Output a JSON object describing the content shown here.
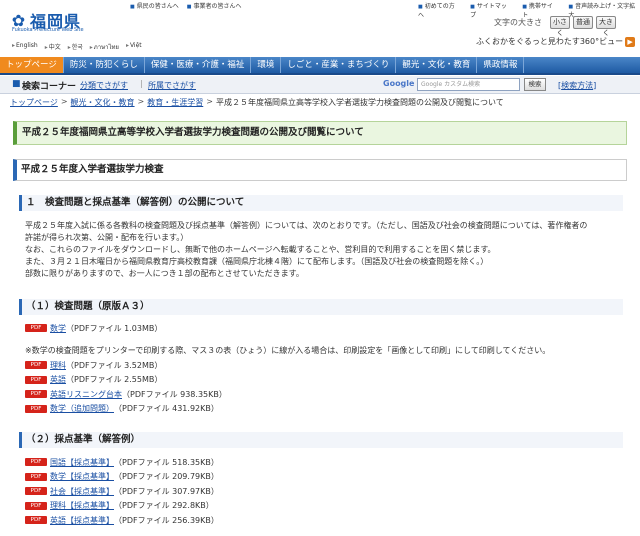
{
  "header": {
    "logo_text": "福岡県",
    "logo_sub": "Fukuoka Prefecture Web Site",
    "languages": [
      "English",
      "中文",
      "한국",
      "ภาษาไทย",
      "Việt"
    ],
    "top_links": [
      "県民の皆さんへ",
      "事業者の皆さんへ"
    ],
    "right_links": [
      "初めての方へ",
      "サイトマップ",
      "携帯サイト",
      "音声読み上げ・文字拡大"
    ],
    "font_size_label": "文字の大きさ",
    "font_buttons": [
      "小さく",
      "普通",
      "大きく"
    ],
    "view360": "ふくおかをぐるっと見わたす360°ビュー"
  },
  "nav": {
    "items": [
      "トップページ",
      "防災・防犯くらし",
      "保健・医療・介護・福祉",
      "環境",
      "しごと・産業・まちづくり",
      "観光・文化・教育",
      "県政情報"
    ]
  },
  "search": {
    "title": "検索コーナー",
    "link_category": "分類でさがす",
    "link_dept": "所属でさがす",
    "google_label": "Google",
    "placeholder": "Google カスタム検索",
    "button": "検索",
    "help_open": "[",
    "help": "検索方法",
    "help_close": "]"
  },
  "breadcrumb": [
    "トップページ",
    "観光・文化・教育",
    "教育・生涯学習",
    "平成２５年度福岡県立高等学校入学者選抜学力検査問題の公開及び閲覧について"
  ],
  "page_title": "平成２５年度福岡県立高等学校入学者選抜学力検査問題の公開及び閲覧について",
  "section_title": "平成２５年度入学者選抜学力検査",
  "subsection_title": "１　検査問題と採点基準（解答例）の公開について",
  "paragraph": [
    "平成２５年度入試に係る各教科の検査問題及び採点基準（解答例）については、次のとおりです。（ただし、国語及び社会の検査問題については、著作権者の",
    "許諾が得られ次第、公開・配布を行います。）",
    "なお、これらのファイルをダウンロードし、無断で他のホームページへ転載することや、営利目的で利用することを固く禁じます。",
    "また、３月２１日木曜日から福岡県教育庁高校教育課（福岡県庁北棟４階）にて配布します。（国語及び社会の検査問題を除く。）",
    "部数に限りがありますので、お一人につき１部の配布とさせていただきます。"
  ],
  "list1_title": "（１）検査問題（原版Ａ３）",
  "list1_first": {
    "link": "数学",
    "size": "（PDFファイル 1.03MB）"
  },
  "note": "※数学の検査問題をプリンターで印刷する際、マス３の表（ひょう）に線が入る場合は、印刷設定を「画像として印刷」にして印刷してください。",
  "list1_rest": [
    {
      "link": "理科",
      "size": "（PDFファイル 3.52MB）"
    },
    {
      "link": "英語",
      "size": "（PDFファイル 2.55MB）"
    },
    {
      "link": "英語リスニング台本",
      "size": "（PDFファイル 938.35KB）"
    },
    {
      "link": "数学（追加問題）",
      "size": "（PDFファイル 431.92KB）"
    }
  ],
  "list2_title": "（２）採点基準（解答例）",
  "list2": [
    {
      "link": "国語【採点基準】",
      "size": "（PDFファイル 518.35KB）"
    },
    {
      "link": "数学【採点基準】",
      "size": "（PDFファイル 209.79KB）"
    },
    {
      "link": "社会【採点基準】",
      "size": "（PDFファイル 307.97KB）"
    },
    {
      "link": "理科【採点基準】",
      "size": "（PDFファイル 292.8KB）"
    },
    {
      "link": "英語【採点基準】",
      "size": "（PDFファイル 256.39KB）"
    }
  ],
  "pdf_badge": "PDF",
  "colors": {
    "nav": "#1e5aa3",
    "nav_active": "#f08a1e",
    "title_bg": "#eaf6e0",
    "pdf": "#d5231a"
  }
}
